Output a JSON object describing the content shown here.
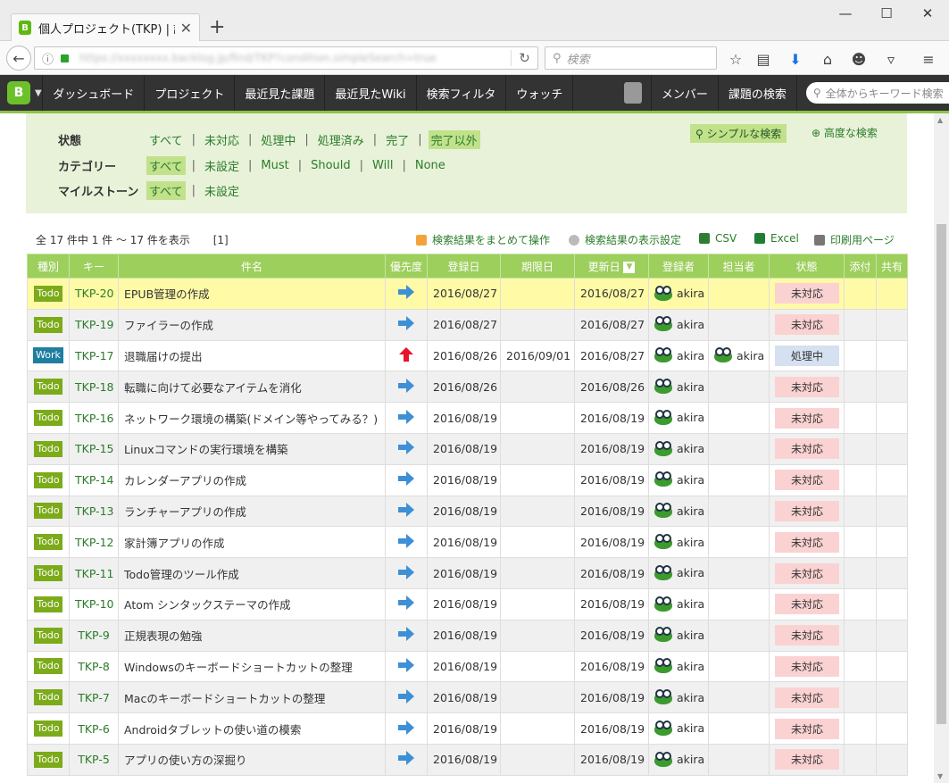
{
  "browser": {
    "tab_title": "個人プロジェクト(TKP) | 課題...",
    "search_placeholder": "検索"
  },
  "appnav": {
    "items": [
      "ダッシュボード",
      "プロジェクト",
      "最近見た課題",
      "最近見たWiki",
      "検索フィルタ",
      "ウォッチ"
    ],
    "members": "メンバー",
    "issue_search": "課題の検索",
    "keyword_placeholder": "全体からキーワード検索"
  },
  "filter": {
    "status_label": "状態",
    "status_options": [
      "すべて",
      "未対応",
      "処理中",
      "処理済み",
      "完了",
      "完了以外"
    ],
    "category_label": "カテゴリー",
    "category_options": [
      "すべて",
      "未設定",
      "Must",
      "Should",
      "Will",
      "None"
    ],
    "milestone_label": "マイルストーン",
    "milestone_options": [
      "すべて",
      "未設定"
    ],
    "simple_search": "シンプルな検索",
    "advanced_search": "高度な検索"
  },
  "summary": {
    "text": "全 17 件中 1 件 〜 17 件を表示",
    "page": "[1]"
  },
  "actions": {
    "bulk": "検索結果をまとめて操作",
    "display_settings": "検索結果の表示設定",
    "csv": "CSV",
    "excel": "Excel",
    "print": "印刷用ページ"
  },
  "table": {
    "headers": [
      "種別",
      "キー",
      "件名",
      "優先度",
      "登録日",
      "期限日",
      "更新日",
      "登録者",
      "担当者",
      "状態",
      "添付",
      "共有"
    ],
    "rows": [
      {
        "type": "Todo",
        "key": "TKP-20",
        "title": "EPUB管理の作成",
        "priority": "normal",
        "created": "2016/08/27",
        "due": "",
        "updated": "2016/08/27",
        "reporter": "akira",
        "assignee": "",
        "status": "未対応"
      },
      {
        "type": "Todo",
        "key": "TKP-19",
        "title": "ファイラーの作成",
        "priority": "normal",
        "created": "2016/08/27",
        "due": "",
        "updated": "2016/08/27",
        "reporter": "akira",
        "assignee": "",
        "status": "未対応"
      },
      {
        "type": "Work",
        "key": "TKP-17",
        "title": "退職届けの提出",
        "priority": "high",
        "created": "2016/08/26",
        "due": "2016/09/01",
        "updated": "2016/08/27",
        "reporter": "akira",
        "assignee": "akira",
        "status": "処理中"
      },
      {
        "type": "Todo",
        "key": "TKP-18",
        "title": "転職に向けて必要なアイテムを消化",
        "priority": "normal",
        "created": "2016/08/26",
        "due": "",
        "updated": "2016/08/26",
        "reporter": "akira",
        "assignee": "",
        "status": "未対応"
      },
      {
        "type": "Todo",
        "key": "TKP-16",
        "title": "ネットワーク環境の構築(ドメイン等やってみる？)",
        "priority": "normal",
        "created": "2016/08/19",
        "due": "",
        "updated": "2016/08/19",
        "reporter": "akira",
        "assignee": "",
        "status": "未対応"
      },
      {
        "type": "Todo",
        "key": "TKP-15",
        "title": "Linuxコマンドの実行環境を構築",
        "priority": "normal",
        "created": "2016/08/19",
        "due": "",
        "updated": "2016/08/19",
        "reporter": "akira",
        "assignee": "",
        "status": "未対応"
      },
      {
        "type": "Todo",
        "key": "TKP-14",
        "title": "カレンダーアプリの作成",
        "priority": "normal",
        "created": "2016/08/19",
        "due": "",
        "updated": "2016/08/19",
        "reporter": "akira",
        "assignee": "",
        "status": "未対応"
      },
      {
        "type": "Todo",
        "key": "TKP-13",
        "title": "ランチャーアプリの作成",
        "priority": "normal",
        "created": "2016/08/19",
        "due": "",
        "updated": "2016/08/19",
        "reporter": "akira",
        "assignee": "",
        "status": "未対応"
      },
      {
        "type": "Todo",
        "key": "TKP-12",
        "title": "家計簿アプリの作成",
        "priority": "normal",
        "created": "2016/08/19",
        "due": "",
        "updated": "2016/08/19",
        "reporter": "akira",
        "assignee": "",
        "status": "未対応"
      },
      {
        "type": "Todo",
        "key": "TKP-11",
        "title": "Todo管理のツール作成",
        "priority": "normal",
        "created": "2016/08/19",
        "due": "",
        "updated": "2016/08/19",
        "reporter": "akira",
        "assignee": "",
        "status": "未対応"
      },
      {
        "type": "Todo",
        "key": "TKP-10",
        "title": "Atom シンタックステーマの作成",
        "priority": "normal",
        "created": "2016/08/19",
        "due": "",
        "updated": "2016/08/19",
        "reporter": "akira",
        "assignee": "",
        "status": "未対応"
      },
      {
        "type": "Todo",
        "key": "TKP-9",
        "title": "正規表現の勉強",
        "priority": "normal",
        "created": "2016/08/19",
        "due": "",
        "updated": "2016/08/19",
        "reporter": "akira",
        "assignee": "",
        "status": "未対応"
      },
      {
        "type": "Todo",
        "key": "TKP-8",
        "title": "Windowsのキーボードショートカットの整理",
        "priority": "normal",
        "created": "2016/08/19",
        "due": "",
        "updated": "2016/08/19",
        "reporter": "akira",
        "assignee": "",
        "status": "未対応"
      },
      {
        "type": "Todo",
        "key": "TKP-7",
        "title": "Macのキーボードショートカットの整理",
        "priority": "normal",
        "created": "2016/08/19",
        "due": "",
        "updated": "2016/08/19",
        "reporter": "akira",
        "assignee": "",
        "status": "未対応"
      },
      {
        "type": "Todo",
        "key": "TKP-6",
        "title": "Androidタブレットの使い道の模索",
        "priority": "normal",
        "created": "2016/08/19",
        "due": "",
        "updated": "2016/08/19",
        "reporter": "akira",
        "assignee": "",
        "status": "未対応"
      },
      {
        "type": "Todo",
        "key": "TKP-5",
        "title": "アプリの使い方の深掘り",
        "priority": "normal",
        "created": "2016/08/19",
        "due": "",
        "updated": "2016/08/19",
        "reporter": "akira",
        "assignee": "",
        "status": "未対応"
      }
    ]
  },
  "colors": {
    "accent_green": "#9dcf5c",
    "todo": "#7cab1a",
    "work": "#1f7fa0",
    "status_open": "#fbd2d2",
    "status_progress": "#d5e0f0"
  }
}
